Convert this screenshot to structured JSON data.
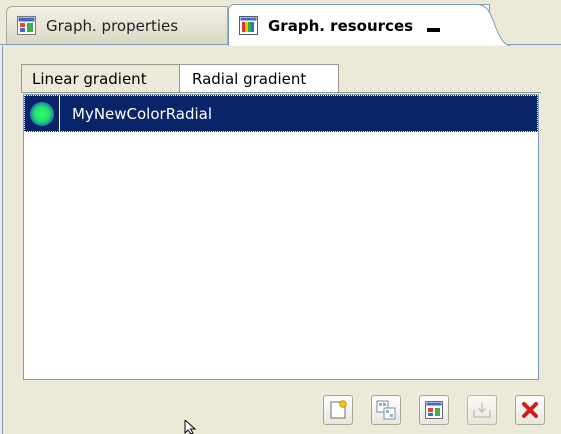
{
  "view_tabs": {
    "graph_properties": "Graph. properties",
    "graph_resources": "Graph. resources"
  },
  "sub_tabs": {
    "linear": "Linear gradient",
    "radial": "Radial gradient"
  },
  "list": {
    "items": [
      {
        "label": "MyNewColorRadial",
        "selected": true,
        "swatch_colors": [
          "#2bff7a",
          "#1837c9"
        ]
      }
    ]
  },
  "toolbar": {
    "buttons": [
      {
        "icon": "new-resource-icon",
        "enabled": true
      },
      {
        "icon": "copy-resource-icon",
        "enabled": true
      },
      {
        "icon": "properties-icon",
        "enabled": true
      },
      {
        "icon": "import-icon",
        "enabled": false
      },
      {
        "icon": "delete-icon",
        "enabled": true
      }
    ]
  },
  "colors": {
    "selection": "#0a246a",
    "panel_bg": "#ece9d8",
    "delete_red": "#d01c1c"
  }
}
